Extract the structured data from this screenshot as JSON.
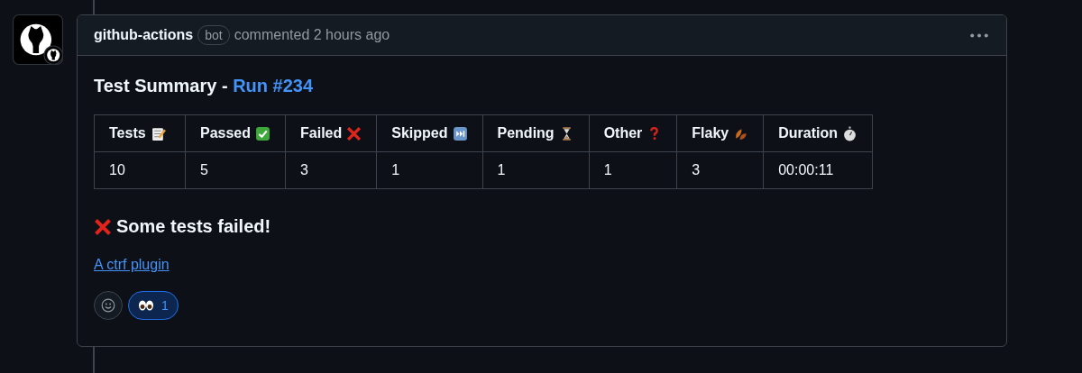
{
  "comment": {
    "author": "github-actions",
    "badge": "bot",
    "meta": "commented 2 hours ago",
    "title": {
      "text": "Test Summary - ",
      "link": "Run #234"
    },
    "table": {
      "columns": [
        "Tests",
        "Passed",
        "Failed",
        "Skipped",
        "Pending",
        "Other",
        "Flaky",
        "Duration"
      ],
      "rows": [
        [
          "10",
          "5",
          "3",
          "1",
          "1",
          "1",
          "3",
          "00:00:11"
        ]
      ]
    },
    "status": "Some tests failed!",
    "link": "A ctrf plugin",
    "reactions": [
      {
        "count": "1",
        "selected": true
      }
    ]
  }
}
